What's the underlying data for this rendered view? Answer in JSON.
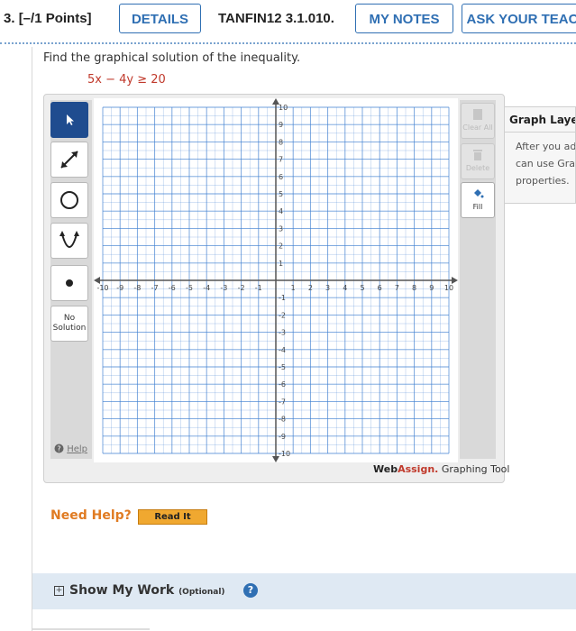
{
  "question": {
    "number": "3.",
    "points": "[–/1 Points]",
    "code": "TANFIN12 3.1.010.",
    "buttons": {
      "details": "DETAILS",
      "my_notes": "MY NOTES",
      "ask_teacher": "ASK YOUR TEAC"
    }
  },
  "prompt": "Find the graphical solution of the inequality.",
  "inequality": "5x − 4y ≥ 20",
  "graph": {
    "x_range": [
      -10,
      10
    ],
    "y_range": [
      -10,
      10
    ],
    "x_tick_labels": [
      "-10",
      "-9",
      "-8",
      "-7",
      "-6",
      "-5",
      "-4",
      "-3",
      "-2",
      "-1",
      "1",
      "2",
      "3",
      "4",
      "5",
      "6",
      "7",
      "8",
      "9",
      "10"
    ],
    "y_tick_labels": [
      "10",
      "9",
      "8",
      "7",
      "6",
      "5",
      "4",
      "3",
      "2",
      "1",
      "-1",
      "-2",
      "-3",
      "-4",
      "-5",
      "-6",
      "-7",
      "-8",
      "-9",
      "-10"
    ],
    "grid_color": "#3f7fd0",
    "axis_color": "#555555"
  },
  "tools": {
    "select": "arrow-pointer-icon",
    "line": "line-tool-icon",
    "circle": "circle-tool-icon",
    "parabola": "parabola-tool-icon",
    "point": "point-tool-icon",
    "no_solution": "No Solution",
    "help": "Help"
  },
  "right_tools": {
    "clear_all": "Clear All",
    "delete": "Delete",
    "fill": "Fill"
  },
  "brand": {
    "web": "Web",
    "assign": "Assign.",
    "suffix": " Graphing Tool"
  },
  "layers": {
    "title": "Graph Layers",
    "line1": "After you ad",
    "line2": "can use Gra",
    "line3": "properties."
  },
  "need_help": "Need Help?",
  "read_it": "Read It",
  "show_work": {
    "label": "Show My Work",
    "optional": "(Optional)",
    "help": "?"
  },
  "colors": {
    "accent": "#2f6fb3",
    "inequality": "#c0392b",
    "need_help": "#e07b22",
    "read_it_bg": "#f0a830"
  }
}
